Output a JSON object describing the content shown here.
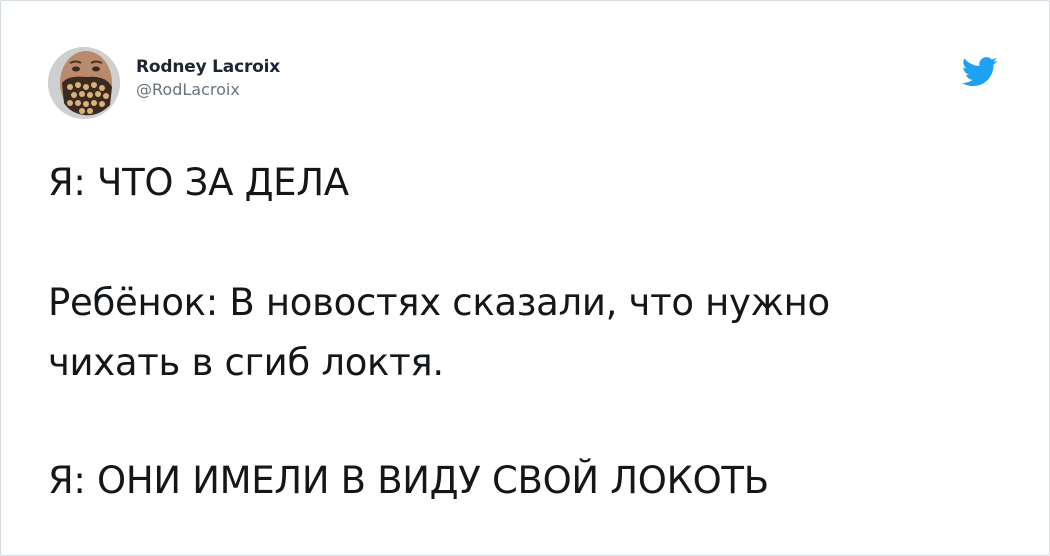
{
  "author": {
    "display_name": "Rodney Lacroix",
    "handle": "@RodLacroix"
  },
  "icons": {
    "avatar": "avatar-photo",
    "brand": "twitter-bird-icon"
  },
  "colors": {
    "brand_blue": "#1da1f2",
    "text_primary": "#14171a",
    "text_secondary": "#66757f"
  },
  "tweet": {
    "lines": [
      "Я: ЧТО ЗА ДЕЛА",
      "Ребёнок: В новостях сказали, что нужно\nчихать в сгиб локтя.",
      "Я: ОНИ ИМЕЛИ В ВИДУ СВОЙ ЛОКОТЬ"
    ]
  }
}
